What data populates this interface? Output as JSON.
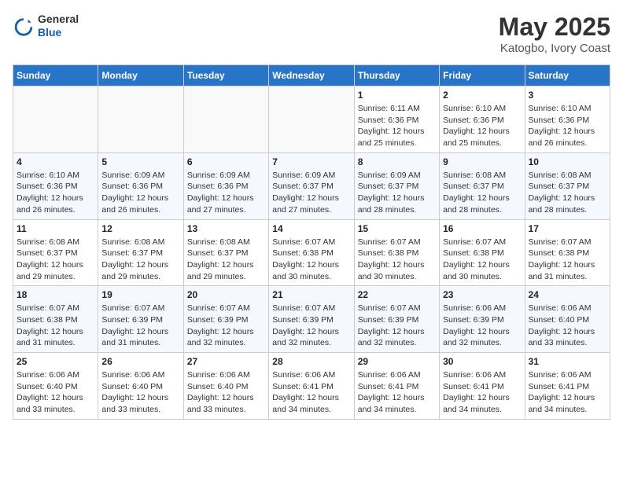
{
  "header": {
    "logo_general": "General",
    "logo_blue": "Blue",
    "month_year": "May 2025",
    "location": "Katogbo, Ivory Coast"
  },
  "days_of_week": [
    "Sunday",
    "Monday",
    "Tuesday",
    "Wednesday",
    "Thursday",
    "Friday",
    "Saturday"
  ],
  "weeks": [
    [
      {
        "num": "",
        "empty": true
      },
      {
        "num": "",
        "empty": true
      },
      {
        "num": "",
        "empty": true
      },
      {
        "num": "",
        "empty": true
      },
      {
        "num": "1",
        "sunrise": "6:11 AM",
        "sunset": "6:36 PM",
        "daylight": "12 hours and 25 minutes."
      },
      {
        "num": "2",
        "sunrise": "6:10 AM",
        "sunset": "6:36 PM",
        "daylight": "12 hours and 25 minutes."
      },
      {
        "num": "3",
        "sunrise": "6:10 AM",
        "sunset": "6:36 PM",
        "daylight": "12 hours and 26 minutes."
      }
    ],
    [
      {
        "num": "4",
        "sunrise": "6:10 AM",
        "sunset": "6:36 PM",
        "daylight": "12 hours and 26 minutes."
      },
      {
        "num": "5",
        "sunrise": "6:09 AM",
        "sunset": "6:36 PM",
        "daylight": "12 hours and 26 minutes."
      },
      {
        "num": "6",
        "sunrise": "6:09 AM",
        "sunset": "6:36 PM",
        "daylight": "12 hours and 27 minutes."
      },
      {
        "num": "7",
        "sunrise": "6:09 AM",
        "sunset": "6:37 PM",
        "daylight": "12 hours and 27 minutes."
      },
      {
        "num": "8",
        "sunrise": "6:09 AM",
        "sunset": "6:37 PM",
        "daylight": "12 hours and 28 minutes."
      },
      {
        "num": "9",
        "sunrise": "6:08 AM",
        "sunset": "6:37 PM",
        "daylight": "12 hours and 28 minutes."
      },
      {
        "num": "10",
        "sunrise": "6:08 AM",
        "sunset": "6:37 PM",
        "daylight": "12 hours and 28 minutes."
      }
    ],
    [
      {
        "num": "11",
        "sunrise": "6:08 AM",
        "sunset": "6:37 PM",
        "daylight": "12 hours and 29 minutes."
      },
      {
        "num": "12",
        "sunrise": "6:08 AM",
        "sunset": "6:37 PM",
        "daylight": "12 hours and 29 minutes."
      },
      {
        "num": "13",
        "sunrise": "6:08 AM",
        "sunset": "6:37 PM",
        "daylight": "12 hours and 29 minutes."
      },
      {
        "num": "14",
        "sunrise": "6:07 AM",
        "sunset": "6:38 PM",
        "daylight": "12 hours and 30 minutes."
      },
      {
        "num": "15",
        "sunrise": "6:07 AM",
        "sunset": "6:38 PM",
        "daylight": "12 hours and 30 minutes."
      },
      {
        "num": "16",
        "sunrise": "6:07 AM",
        "sunset": "6:38 PM",
        "daylight": "12 hours and 30 minutes."
      },
      {
        "num": "17",
        "sunrise": "6:07 AM",
        "sunset": "6:38 PM",
        "daylight": "12 hours and 31 minutes."
      }
    ],
    [
      {
        "num": "18",
        "sunrise": "6:07 AM",
        "sunset": "6:38 PM",
        "daylight": "12 hours and 31 minutes."
      },
      {
        "num": "19",
        "sunrise": "6:07 AM",
        "sunset": "6:39 PM",
        "daylight": "12 hours and 31 minutes."
      },
      {
        "num": "20",
        "sunrise": "6:07 AM",
        "sunset": "6:39 PM",
        "daylight": "12 hours and 32 minutes."
      },
      {
        "num": "21",
        "sunrise": "6:07 AM",
        "sunset": "6:39 PM",
        "daylight": "12 hours and 32 minutes."
      },
      {
        "num": "22",
        "sunrise": "6:07 AM",
        "sunset": "6:39 PM",
        "daylight": "12 hours and 32 minutes."
      },
      {
        "num": "23",
        "sunrise": "6:06 AM",
        "sunset": "6:39 PM",
        "daylight": "12 hours and 32 minutes."
      },
      {
        "num": "24",
        "sunrise": "6:06 AM",
        "sunset": "6:40 PM",
        "daylight": "12 hours and 33 minutes."
      }
    ],
    [
      {
        "num": "25",
        "sunrise": "6:06 AM",
        "sunset": "6:40 PM",
        "daylight": "12 hours and 33 minutes."
      },
      {
        "num": "26",
        "sunrise": "6:06 AM",
        "sunset": "6:40 PM",
        "daylight": "12 hours and 33 minutes."
      },
      {
        "num": "27",
        "sunrise": "6:06 AM",
        "sunset": "6:40 PM",
        "daylight": "12 hours and 33 minutes."
      },
      {
        "num": "28",
        "sunrise": "6:06 AM",
        "sunset": "6:41 PM",
        "daylight": "12 hours and 34 minutes."
      },
      {
        "num": "29",
        "sunrise": "6:06 AM",
        "sunset": "6:41 PM",
        "daylight": "12 hours and 34 minutes."
      },
      {
        "num": "30",
        "sunrise": "6:06 AM",
        "sunset": "6:41 PM",
        "daylight": "12 hours and 34 minutes."
      },
      {
        "num": "31",
        "sunrise": "6:06 AM",
        "sunset": "6:41 PM",
        "daylight": "12 hours and 34 minutes."
      }
    ]
  ]
}
